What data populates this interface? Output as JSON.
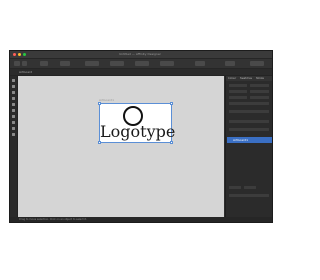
{
  "window": {
    "title": "Untitled — Affinity Designer"
  },
  "context_bar": {
    "label": "Artboard"
  },
  "document": {
    "label": "Artboard1",
    "logo_text": "Logotype"
  },
  "panel": {
    "tabs": [
      "Colour",
      "Swatches",
      "Stroke"
    ],
    "layer_name": "Artboard1"
  },
  "status_bar": {
    "text": "Drag to move selection. Click on an object to select it."
  },
  "colors": {
    "accent": "#3a6fc4",
    "canvas": "#d5d5d5",
    "chrome": "#2e2e2e"
  }
}
